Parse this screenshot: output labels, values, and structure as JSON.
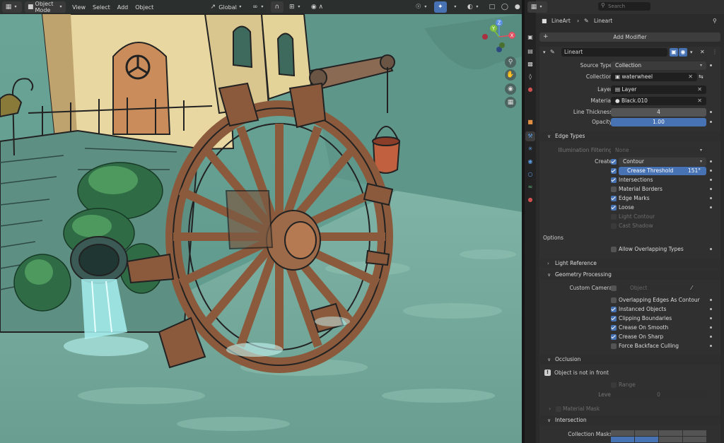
{
  "viewport": {
    "mode_label": "Object Mode",
    "menus": [
      "View",
      "Select",
      "Add",
      "Object"
    ],
    "transform_orientation": "Global",
    "gizmo_axes": {
      "x": "X",
      "y": "Y",
      "z": "Z"
    }
  },
  "properties": {
    "search_placeholder": "Search",
    "breadcrumb": {
      "object": "LineArt",
      "modifier": "Lineart"
    },
    "add_modifier_label": "Add Modifier",
    "modifier_name": "Lineart",
    "fields": {
      "source_type": {
        "label": "Source Type",
        "value": "Collection"
      },
      "collection": {
        "label": "Collection",
        "value": "waterwheel"
      },
      "layer": {
        "label": "Layer",
        "value": "Layer"
      },
      "material": {
        "label": "Material",
        "value": "Black.010"
      },
      "line_thickness": {
        "label": "Line Thickness",
        "value": "4"
      },
      "opacity": {
        "label": "Opacity",
        "value": "1.00"
      }
    },
    "edge_types": {
      "title": "Edge Types",
      "illumination_label": "Illumination Filtering",
      "illumination_value": "None",
      "create_label": "Create",
      "create_value": "Contour",
      "crease_label": "Crease Threshold",
      "crease_value": "151°",
      "items": [
        {
          "label": "Intersections",
          "checked": true,
          "enabled": true
        },
        {
          "label": "Material Borders",
          "checked": false,
          "enabled": true
        },
        {
          "label": "Edge Marks",
          "checked": true,
          "enabled": true
        },
        {
          "label": "Loose",
          "checked": true,
          "enabled": true
        },
        {
          "label": "Light Contour",
          "checked": false,
          "enabled": false
        },
        {
          "label": "Cast Shadow",
          "checked": false,
          "enabled": false
        }
      ]
    },
    "options": {
      "title": "Options",
      "allow_overlapping": "Allow Overlapping Types"
    },
    "light_reference": {
      "title": "Light Reference"
    },
    "geometry": {
      "title": "Geometry Processing",
      "custom_camera_label": "Custom Camera",
      "camera_placeholder": "Object",
      "items": [
        {
          "label": "Overlapping Edges As Contour",
          "checked": false
        },
        {
          "label": "Instanced Objects",
          "checked": true
        },
        {
          "label": "Clipping Boundaries",
          "checked": true
        },
        {
          "label": "Crease On Smooth",
          "checked": true
        },
        {
          "label": "Crease On Sharp",
          "checked": true
        },
        {
          "label": "Force Backface Culling",
          "checked": false
        }
      ]
    },
    "occlusion": {
      "title": "Occlusion",
      "info": "Object is not in front",
      "range_label": "Range",
      "level_label": "Level",
      "level_value": "0",
      "material_mask": "Material Mask"
    },
    "intersection": {
      "title": "Intersection",
      "collection_masks": "Collection Masks"
    }
  },
  "colors": {
    "accent": "#4772b3",
    "panel": "#2b2b2b",
    "viewport_bg": "#6a9f92"
  }
}
